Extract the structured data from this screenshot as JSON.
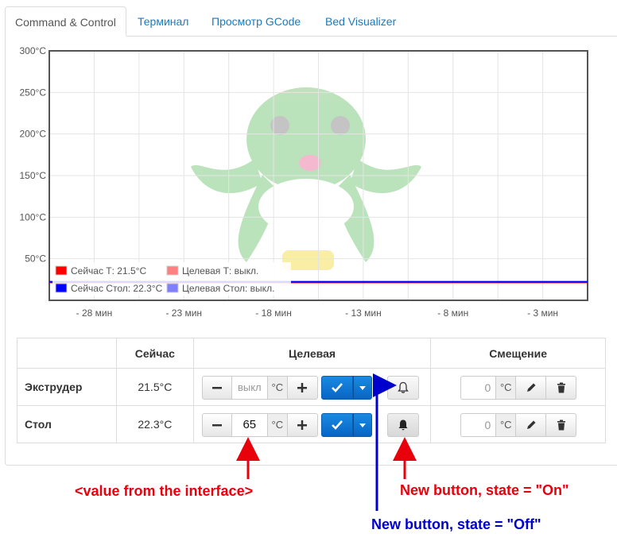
{
  "tabs": [
    {
      "label": "Command & Control",
      "active": true
    },
    {
      "label": "Терминал"
    },
    {
      "label": "Просмотр GCode"
    },
    {
      "label": "Bed Visualizer"
    }
  ],
  "chart_data": {
    "type": "line",
    "x_tick_labels": [
      "- 28 мин",
      "- 23 мин",
      "- 18 мин",
      "- 13 мин",
      "- 8 мин",
      "- 3 мин"
    ],
    "y_tick_labels": [
      "50°C",
      "100°C",
      "150°C",
      "200°C",
      "250°C",
      "300°C"
    ],
    "ylim": [
      0,
      300
    ],
    "grid": true,
    "legend": [
      {
        "label": "Сейчас Т: 21.5°C",
        "color": "#ff0000"
      },
      {
        "label": "Целевая Т: выкл.",
        "color": "#ff8080"
      },
      {
        "label": "Сейчас Стол: 22.3°C",
        "color": "#0000ff"
      },
      {
        "label": "Целевая Стол: выкл.",
        "color": "#8080ff"
      }
    ],
    "series": [
      {
        "name": "Сейчас Т: 21.5°C",
        "value": 21.5,
        "color": "#ff0000"
      },
      {
        "name": "Сейчас Стол: 22.3°C",
        "value": 22.3,
        "color": "#0000ff"
      }
    ]
  },
  "table": {
    "headers": [
      "",
      "Сейчас",
      "Целевая",
      "Смещение"
    ],
    "rows": [
      {
        "label": "Экструдер",
        "current": "21.5°C",
        "target_value": "",
        "target_placeholder": "выкл",
        "unit": "°C",
        "offset_placeholder": "0"
      },
      {
        "label": "Стол",
        "current": "22.3°C",
        "target_value": "65",
        "target_placeholder": "",
        "unit": "°C",
        "offset_placeholder": "0"
      }
    ]
  },
  "annotations": {
    "value_label": "<value from the interface>",
    "on_label": "New button, state = \"On\"",
    "off_label": "New button, state = \"Off\"",
    "red": "#e8000b",
    "blue": "#0000cc"
  }
}
